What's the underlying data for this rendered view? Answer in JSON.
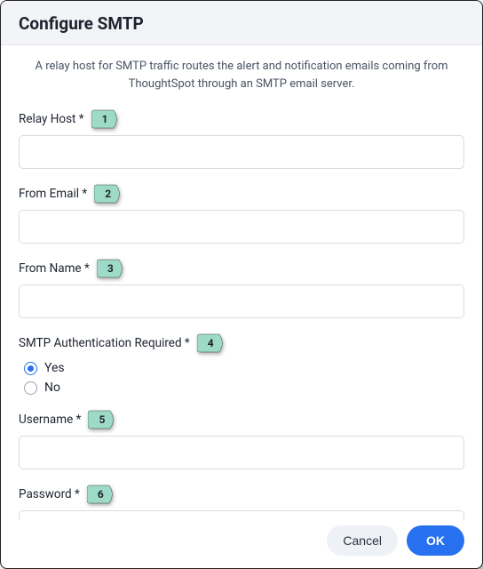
{
  "dialog": {
    "title": "Configure SMTP",
    "description": "A relay host for SMTP traffic routes the alert and notification emails coming from ThoughtSpot through an SMTP email server."
  },
  "fields": {
    "relay_host": {
      "label": "Relay Host *",
      "value": "",
      "pin": "1"
    },
    "from_email": {
      "label": "From Email *",
      "value": "",
      "pin": "2"
    },
    "from_name": {
      "label": "From Name *",
      "value": "",
      "pin": "3"
    },
    "auth_required": {
      "label": "SMTP Authentication Required *",
      "pin": "4",
      "options": {
        "yes": "Yes",
        "no": "No"
      },
      "selected": "yes"
    },
    "username": {
      "label": "Username *",
      "value": "",
      "pin": "5"
    },
    "password": {
      "label": "Password *",
      "value": "",
      "pin": "6"
    }
  },
  "buttons": {
    "cancel": "Cancel",
    "ok": "OK"
  },
  "colors": {
    "pin_fill": "#9edbc6",
    "accent": "#2770ef"
  }
}
